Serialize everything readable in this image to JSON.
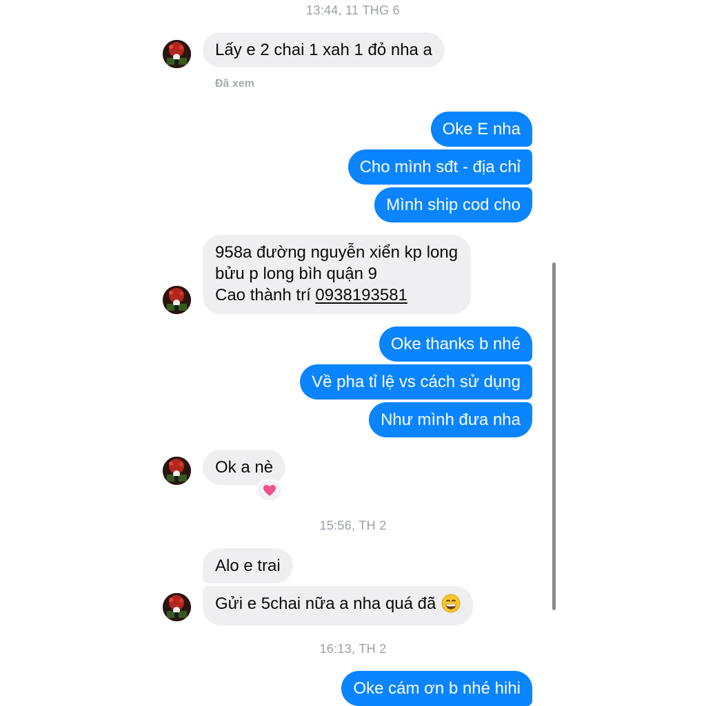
{
  "timestamps": [
    "13:44, 11 THG 6",
    "15:56, TH 2",
    "16:13, TH 2"
  ],
  "seen_label": "Đã xem",
  "messages": [
    {
      "from": "them",
      "text": "Lấy e 2 chai 1 xah 1 đỏ nha a"
    },
    {
      "from": "me",
      "text": "Oke E nha"
    },
    {
      "from": "me",
      "text": "Cho mình sđt - địa chỉ"
    },
    {
      "from": "me",
      "text": "Mình ship cod cho"
    },
    {
      "from": "them",
      "lines": [
        "958a đường nguyễn xiển kp long",
        "bửu p long bìh quận 9",
        "Cao thành trí "
      ],
      "phone": "0938193581"
    },
    {
      "from": "me",
      "text": "Oke thanks b nhé"
    },
    {
      "from": "me",
      "text": "Về pha tỉ lệ vs cách sử dụng"
    },
    {
      "from": "me",
      "text": "Như mình đưa nha"
    },
    {
      "from": "them",
      "text": "Ok a nè",
      "reaction": "heart"
    },
    {
      "from": "them",
      "text": "Alo e trai"
    },
    {
      "from": "them",
      "text": "Gửi e 5chai nữa a nha quá đã",
      "emoji": "grinning-face"
    },
    {
      "from": "me",
      "text": "Oke cám ơn b nhé hihi"
    }
  ],
  "colors": {
    "outgoing": "#0a84ff",
    "incoming": "#efeff1",
    "reaction": "#f0508c"
  }
}
